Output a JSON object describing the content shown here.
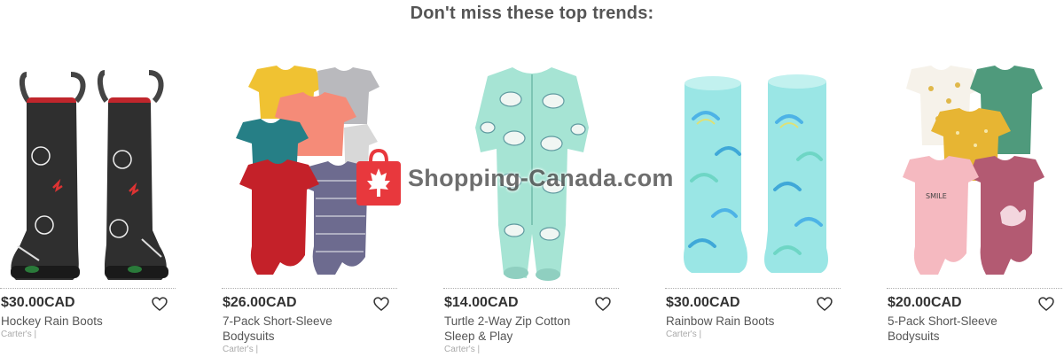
{
  "section": {
    "heading": "Don't miss these top trends:"
  },
  "products": [
    {
      "price": "$30.00CAD",
      "name": "Hockey Rain Boots",
      "brand": "Carter's |",
      "image": "black hockey rain boots"
    },
    {
      "price": "$26.00CAD",
      "name": "7-Pack Short-Sleeve Bodysuits",
      "brand": "Carter's |",
      "image": "stack of colorful bodysuits"
    },
    {
      "price": "$14.00CAD",
      "name": "Turtle 2-Way Zip Cotton Sleep & Play",
      "brand": "Carter's |",
      "image": "mint turtle sleep and play"
    },
    {
      "price": "$30.00CAD",
      "name": "Rainbow Rain Boots",
      "brand": "Carter's |",
      "image": "clear aqua rainbow rain boots"
    },
    {
      "price": "$20.00CAD",
      "name": "5-Pack Short-Sleeve Bodysuits",
      "brand": "Carter's |",
      "image": "floral and pink bodysuits"
    }
  ],
  "watermark": {
    "text": "Shopping-Canada.com",
    "icon": "maple-leaf-bag-icon",
    "color": "#e8383d"
  },
  "icons": {
    "wishlist": "heart-outline-icon"
  }
}
